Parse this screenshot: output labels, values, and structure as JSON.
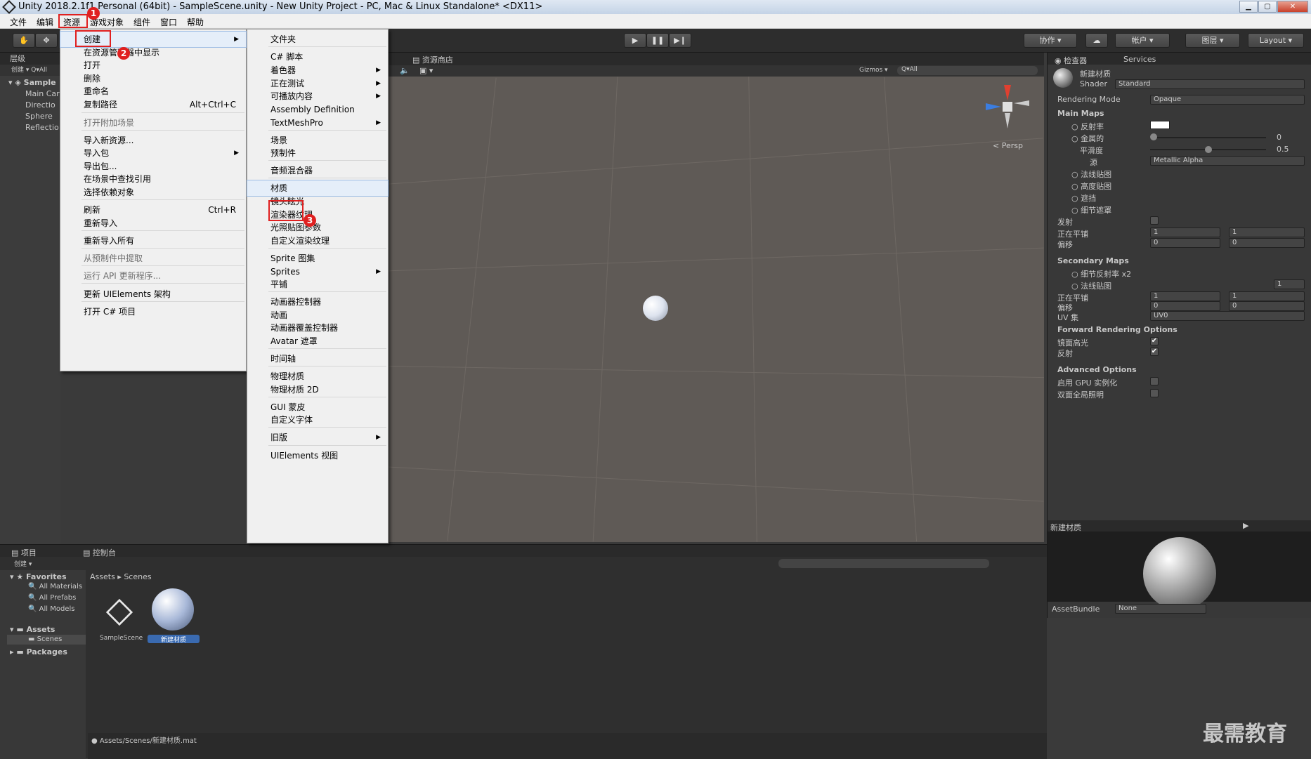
{
  "window": {
    "title": "Unity 2018.2.1f1 Personal (64bit) - SampleScene.unity - New Unity Project - PC, Mac & Linux Standalone* <DX11>"
  },
  "menubar": [
    "文件",
    "编辑",
    "资源",
    "游戏对象",
    "组件",
    "窗口",
    "帮助"
  ],
  "toolbar": {
    "collab": "协作",
    "account": "帐户",
    "layers": "图层",
    "layout": "Layout"
  },
  "hierarchy": {
    "tab": "层级",
    "create": "创建",
    "search": "Q▾All",
    "scene": "Sample",
    "items": [
      "Main Car",
      "Directio",
      "Sphere",
      "Reflectio"
    ]
  },
  "scene": {
    "tab": "资源商店",
    "gizmos": "Gizmos",
    "search": "Q▾All",
    "persp": "Persp"
  },
  "menu_assets": [
    {
      "label": "创建",
      "submenu": true
    },
    {
      "label": "在资源管理器中显示"
    },
    {
      "label": "打开"
    },
    {
      "label": "删除"
    },
    {
      "label": "重命名"
    },
    {
      "label": "复制路径",
      "shortcut": "Alt+Ctrl+C"
    },
    {
      "label": "打开附加场景",
      "disabled": true
    },
    {
      "label": "导入新资源..."
    },
    {
      "label": "导入包",
      "submenu": true
    },
    {
      "label": "导出包..."
    },
    {
      "label": "在场景中查找引用"
    },
    {
      "label": "选择依赖对象"
    },
    {
      "label": "刷新",
      "shortcut": "Ctrl+R"
    },
    {
      "label": "重新导入"
    },
    {
      "label": "重新导入所有"
    },
    {
      "label": "从预制件中提取",
      "disabled": true
    },
    {
      "label": "运行 API 更新程序...",
      "disabled": true
    },
    {
      "label": "更新 UIElements 架构"
    },
    {
      "label": "打开 C# 项目"
    }
  ],
  "menu_create": [
    {
      "label": "文件夹"
    },
    {
      "label": "C# 脚本"
    },
    {
      "label": "着色器",
      "submenu": true
    },
    {
      "label": "正在测试",
      "submenu": true
    },
    {
      "label": "可播放内容",
      "submenu": true
    },
    {
      "label": "Assembly Definition"
    },
    {
      "label": "TextMeshPro",
      "submenu": true
    },
    {
      "label": "场景"
    },
    {
      "label": "预制件"
    },
    {
      "label": "音频混合器"
    },
    {
      "label": "材质"
    },
    {
      "label": "镜头眩光"
    },
    {
      "label": "渲染器纹理"
    },
    {
      "label": "光照贴图参数"
    },
    {
      "label": "自定义渲染纹理"
    },
    {
      "label": "Sprite 图集"
    },
    {
      "label": "Sprites",
      "submenu": true
    },
    {
      "label": "平铺"
    },
    {
      "label": "动画器控制器"
    },
    {
      "label": "动画"
    },
    {
      "label": "动画器覆盖控制器"
    },
    {
      "label": "Avatar 遮罩"
    },
    {
      "label": "时间轴"
    },
    {
      "label": "物理材质"
    },
    {
      "label": "物理材质 2D"
    },
    {
      "label": "GUI 蒙皮"
    },
    {
      "label": "自定义字体"
    },
    {
      "label": "旧版",
      "submenu": true
    },
    {
      "label": "UIElements 视图"
    }
  ],
  "inspector": {
    "tab": "检查器",
    "services": "Services",
    "name": "新建材质",
    "shader_label": "Shader",
    "shader": "Standard",
    "rendering_mode_label": "Rendering Mode",
    "rendering_mode": "Opaque",
    "main_maps": "Main Maps",
    "albedo": "反射率",
    "metallic": "金属的",
    "metallic_val": "0",
    "smoothness": "平滑度",
    "smoothness_val": "0.5",
    "smoothness_fraction": 0.5,
    "source": "源",
    "source_val": "Metallic Alpha",
    "normal": "法线贴图",
    "height": "高度贴图",
    "occlusion": "遮挡",
    "detail_mask": "细节遮罩",
    "emission": "发射",
    "tiling": "正在平铺",
    "offset": "偏移",
    "tx": "1",
    "ty": "1",
    "ox": "0",
    "oy": "0",
    "secondary_maps": "Secondary Maps",
    "detail_albedo": "细节反射率 x2",
    "normal2": "法线贴图",
    "normal2_val": "1",
    "tiling2": "正在平铺",
    "offset2": "偏移",
    "uv": "UV 集",
    "uv_val": "UV0",
    "forward": "Forward Rendering Options",
    "specular": "镜面高光",
    "reflections": "反射",
    "advanced": "Advanced Options",
    "gpu": "启用 GPU 实例化",
    "double": "双面全局照明",
    "preview_title": "新建材质",
    "assetbundle": "AssetBundle",
    "assetbundle_val": "None"
  },
  "project": {
    "tab": "项目",
    "console": "控制台",
    "create": "创建",
    "favorites": "Favorites",
    "fav_items": [
      "All Materials",
      "All Prefabs",
      "All Models"
    ],
    "assets": "Assets",
    "scenes": "Scenes",
    "packages": "Packages",
    "breadcrumb": [
      "Assets",
      "Scenes"
    ],
    "files": [
      "SampleScene",
      "新建材质"
    ],
    "status": "Assets/Scenes/新建材质.mat"
  },
  "watermark": "最需教育",
  "annotations": [
    "1",
    "2",
    "3"
  ]
}
